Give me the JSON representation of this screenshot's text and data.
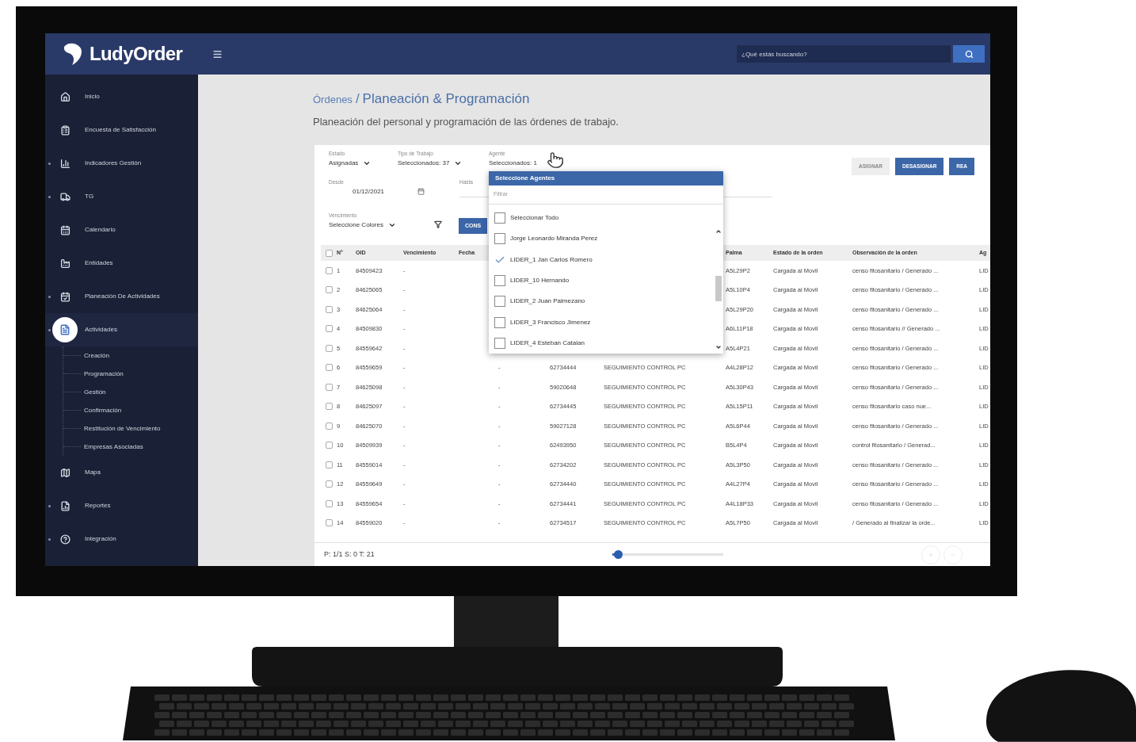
{
  "app": {
    "name": "LudyOrder"
  },
  "search": {
    "placeholder": "¿Qué estás buscando?"
  },
  "sidebar": {
    "items": [
      {
        "label": "Inicio",
        "expandable": false,
        "selected": false
      },
      {
        "label": "Encuesta de Satisfacción",
        "expandable": false,
        "selected": false
      },
      {
        "label": "Indicadores Gestión",
        "expandable": true,
        "selected": false
      },
      {
        "label": "TG",
        "expandable": true,
        "selected": false
      },
      {
        "label": "Calendario",
        "expandable": false,
        "selected": false
      },
      {
        "label": "Entidades",
        "expandable": false,
        "selected": false
      },
      {
        "label": "Planeación De Actividades",
        "expandable": true,
        "selected": false
      },
      {
        "label": "Actividades",
        "expandable": true,
        "selected": true,
        "children": [
          {
            "label": "Creación"
          },
          {
            "label": "Programación"
          },
          {
            "label": "Gestión"
          },
          {
            "label": "Confirmación"
          },
          {
            "label": "Restitución de Vencimiento"
          },
          {
            "label": "Empresas Asociadas"
          }
        ]
      },
      {
        "label": "Mapa",
        "expandable": false,
        "selected": false
      },
      {
        "label": "Reportes",
        "expandable": true,
        "selected": false
      },
      {
        "label": "Integración",
        "expandable": true,
        "selected": false
      }
    ]
  },
  "breadcrumb": {
    "parent": "Órdenes",
    "separator": "/",
    "current": "Planeación & Programación"
  },
  "subtitle": "Planeación del personal y programación de las órdenes de trabajo.",
  "filters": [
    {
      "label": "Estado",
      "value": "Asignadas",
      "kind": "select"
    },
    {
      "label": "Tipo de Trabajo",
      "value": "Seleccionados: 37",
      "kind": "select"
    },
    {
      "label": "Agente",
      "value": "Seleccionados: 1",
      "kind": "text"
    },
    {
      "label": "Desde",
      "value": "01/12/2021",
      "kind": "date"
    },
    {
      "label": "Hasta",
      "kind": "text"
    },
    {
      "label": "Vencimiento",
      "value": "Seleccione Colores",
      "kind": "select"
    }
  ],
  "consult_button": "CONS",
  "actions": [
    {
      "label": "ASIGNAR",
      "disabled": true
    },
    {
      "label": "DESASIGNAR",
      "disabled": false
    },
    {
      "label": "REA",
      "disabled": false
    }
  ],
  "agent_dropdown": {
    "title": "Seleccione Agentes",
    "filter_placeholder": "Filtrar",
    "options": [
      {
        "label": "Seleccionar Todo",
        "checked": false
      },
      {
        "label": "Jorge Leonardo Miranda Perez",
        "checked": false
      },
      {
        "label": "LIDER_1 Jan Carlos Romero",
        "checked": true
      },
      {
        "label": "LIDER_10 Hernando",
        "checked": false
      },
      {
        "label": "LIDER_2 Juan Palmezano",
        "checked": false
      },
      {
        "label": "LIDER_3 Francisco Jimenez",
        "checked": false
      },
      {
        "label": "LIDER_4 Esteban Catalan",
        "checked": false
      }
    ]
  },
  "table": {
    "all_selected": false,
    "columns": [
      "N°",
      "OID",
      "Vencimiento",
      "Fecha",
      "Palma",
      "Estado de la orden",
      "Observación de la orden",
      "Ag"
    ],
    "rows": [
      {
        "selected": false,
        "n": "1",
        "oid": "84509423",
        "vencimiento": "-",
        "palma": "A5L29P2",
        "estado": "Cargada al Movil",
        "observacion": "censo fitosanitario / Generado ...",
        "agente": "LID"
      },
      {
        "selected": false,
        "n": "2",
        "oid": "84625065",
        "vencimiento": "-",
        "palma": "A5L10P4",
        "estado": "Cargada al Movil",
        "observacion": "censo fitosanitario / Generado ...",
        "agente": "LID"
      },
      {
        "selected": false,
        "n": "3",
        "oid": "84625064",
        "vencimiento": "-",
        "palma": "A5L29P20",
        "estado": "Cargada al Movil",
        "observacion": "censo fitosanitario / Generado ...",
        "agente": "LID"
      },
      {
        "selected": false,
        "n": "4",
        "oid": "84509830",
        "vencimiento": "-",
        "palma": "A6L11P18",
        "estado": "Cargada al Movil",
        "observacion": "censo fitosanitario // Generado ...",
        "agente": "LID"
      },
      {
        "selected": false,
        "n": "5",
        "oid": "84559642",
        "vencimiento": "-",
        "palma": "A5L4P21",
        "estado": "Cargada al Movil",
        "observacion": "censo fitosanitario / Generado ...",
        "agente": "LID"
      },
      {
        "selected": false,
        "n": "6",
        "oid": "84559659",
        "vencimiento": "-",
        "fecha": "-",
        "codigo": "62734444",
        "actividad": "SEGUIMIENTO CONTROL PC",
        "palma": "A4L28P12",
        "estado": "Cargada al Movil",
        "observacion": "censo fitosanitario / Generado ...",
        "agente": "LID"
      },
      {
        "selected": false,
        "n": "7",
        "oid": "84625098",
        "vencimiento": "-",
        "fecha": "-",
        "codigo": "59020648",
        "actividad": "SEGUIMIENTO CONTROL PC",
        "palma": "A5L30P43",
        "estado": "Cargada al Movil",
        "observacion": "censo fitosanitario / Generado ...",
        "agente": "LID"
      },
      {
        "selected": false,
        "n": "8",
        "oid": "84625097",
        "vencimiento": "-",
        "fecha": "-",
        "codigo": "62734445",
        "actividad": "SEGUIMIENTO CONTROL PC",
        "palma": "A5L15P11",
        "estado": "Cargada al Movil",
        "observacion": "censo fitosanitario caso nue...",
        "agente": "LID"
      },
      {
        "selected": false,
        "n": "9",
        "oid": "84625070",
        "vencimiento": "-",
        "fecha": "-",
        "codigo": "59027128",
        "actividad": "SEGUIMIENTO CONTROL PC",
        "palma": "A5L6P44",
        "estado": "Cargada al Movil",
        "observacion": "censo fitosanitario / Generado ...",
        "agente": "LID"
      },
      {
        "selected": false,
        "n": "10",
        "oid": "84509939",
        "vencimiento": "-",
        "fecha": "-",
        "codigo": "62493950",
        "actividad": "SEGUIMIENTO CONTROL PC",
        "palma": "B5L4P4",
        "estado": "Cargada al Movil",
        "observacion": "control fitosanitario / Generad...",
        "agente": "LID"
      },
      {
        "selected": false,
        "n": "11",
        "oid": "84559014",
        "vencimiento": "-",
        "fecha": "-",
        "codigo": "62734202",
        "actividad": "SEGUIMIENTO CONTROL PC",
        "palma": "A5L3P50",
        "estado": "Cargada al Movil",
        "observacion": "censo fitosanitario / Generado ...",
        "agente": "LID"
      },
      {
        "selected": false,
        "n": "12",
        "oid": "84559649",
        "vencimiento": "-",
        "fecha": "-",
        "codigo": "62734440",
        "actividad": "SEGUIMIENTO CONTROL PC",
        "palma": "A4L27P4",
        "estado": "Cargada al Movil",
        "observacion": "censo fitosanitario / Generado ...",
        "agente": "LID"
      },
      {
        "selected": false,
        "n": "13",
        "oid": "84559654",
        "vencimiento": "-",
        "fecha": "-",
        "codigo": "62734441",
        "actividad": "SEGUIMIENTO CONTROL PC",
        "palma": "A4L18P33",
        "estado": "Cargada al Movil",
        "observacion": "censo fitosanitario / Generado ...",
        "agente": "LID"
      },
      {
        "selected": false,
        "n": "14",
        "oid": "84559020",
        "vencimiento": "-",
        "fecha": "-",
        "codigo": "62734517",
        "actividad": "SEGUIMIENTO CONTROL PC",
        "palma": "A5L7P50",
        "estado": "Cargada al Movil",
        "observacion": "/ Generado al finalizar la orde...",
        "agente": "LID"
      }
    ]
  },
  "footer": {
    "status": "P: 1/1 S: 0 T: 21",
    "zoom_slider": {
      "level": 0.05
    }
  }
}
